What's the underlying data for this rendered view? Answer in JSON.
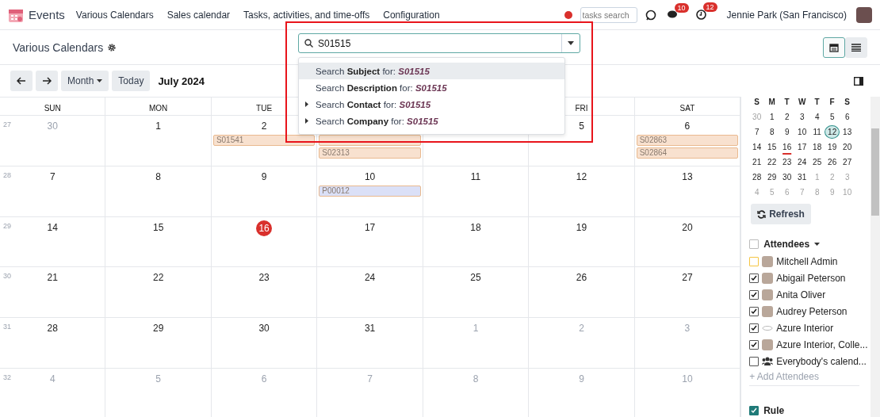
{
  "navbar": {
    "app_name": "Events",
    "menus": [
      "Various Calendars",
      "Sales calendar",
      "Tasks, activities, and time-offs",
      "Configuration"
    ],
    "tasks_search": {
      "placeholder": "tasks search"
    },
    "messages_badge": "10",
    "activities_badge": "12",
    "user": "Jennie Park (San Francisco)"
  },
  "control_panel": {
    "breadcrumb": "Various Calendars",
    "search": {
      "value": "S01515"
    },
    "suggestions": [
      {
        "prefix": "Search",
        "field": "Subject",
        "middle": "for:",
        "term": "S01515",
        "expandable": false,
        "selected": true
      },
      {
        "prefix": "Search",
        "field": "Description",
        "middle": "for:",
        "term": "S01515",
        "expandable": false,
        "selected": false
      },
      {
        "prefix": "Search",
        "field": "Contact",
        "middle": "for:",
        "term": "S01515",
        "expandable": true,
        "selected": false
      },
      {
        "prefix": "Search",
        "field": "Company",
        "middle": "for:",
        "term": "S01515",
        "expandable": true,
        "selected": false
      }
    ],
    "views": [
      {
        "kind": "calendar",
        "selected": true
      },
      {
        "kind": "list",
        "selected": false
      }
    ]
  },
  "toolbar": {
    "scale": "Month",
    "today": "Today",
    "period": "July 2024"
  },
  "calendar": {
    "weekdays_left": [
      "SUN",
      "MON",
      "TUE"
    ],
    "weekdays_right": [
      "FRI",
      "SAT"
    ],
    "weeks": [
      {
        "number": "27",
        "days_left": [
          {
            "label": "30",
            "muted": true,
            "today": false
          },
          {
            "label": "1",
            "muted": false,
            "today": false
          },
          {
            "label": "2",
            "muted": false,
            "today": false,
            "events": [
              {
                "label": "S01541",
                "color": "#f8e1cf"
              }
            ]
          },
          {
            "events": [
              {
                "color": "#f8e1cf"
              },
              {
                "label": "S02313",
                "color": "#f8e1cf"
              }
            ]
          }
        ],
        "days_right": [
          {
            "label": "5",
            "muted": false,
            "today": false
          },
          {
            "label": "6",
            "muted": false,
            "today": false,
            "events": [
              {
                "label": "S02863",
                "color": "#f8e1cf"
              },
              {
                "label": "S02864",
                "color": "#f8e1cf"
              }
            ]
          }
        ]
      },
      {
        "number": "28",
        "days": [
          {
            "label": "7",
            "muted": false,
            "today": false
          },
          {
            "label": "8",
            "muted": false,
            "today": false
          },
          {
            "label": "9",
            "muted": false,
            "today": false
          },
          {
            "label": "10",
            "muted": false,
            "today": false,
            "events": [
              {
                "label": "P00012",
                "color": "#dbe0f7"
              }
            ]
          },
          {
            "label": "11",
            "muted": false,
            "today": false
          },
          {
            "label": "12",
            "muted": false,
            "today": false
          },
          {
            "label": "13",
            "muted": false,
            "today": false
          }
        ]
      },
      {
        "number": "29",
        "days": [
          {
            "label": "14",
            "muted": false,
            "today": false
          },
          {
            "label": "15",
            "muted": false,
            "today": false
          },
          {
            "label": "16",
            "muted": false,
            "today": true
          },
          {
            "label": "17",
            "muted": false,
            "today": false
          },
          {
            "label": "18",
            "muted": false,
            "today": false
          },
          {
            "label": "19",
            "muted": false,
            "today": false
          },
          {
            "label": "20",
            "muted": false,
            "today": false
          }
        ]
      },
      {
        "number": "30",
        "days": [
          {
            "label": "21",
            "muted": false,
            "today": false
          },
          {
            "label": "22",
            "muted": false,
            "today": false
          },
          {
            "label": "23",
            "muted": false,
            "today": false
          },
          {
            "label": "24",
            "muted": false,
            "today": false
          },
          {
            "label": "25",
            "muted": false,
            "today": false
          },
          {
            "label": "26",
            "muted": false,
            "today": false
          },
          {
            "label": "27",
            "muted": false,
            "today": false
          }
        ]
      },
      {
        "number": "31",
        "days": [
          {
            "label": "28",
            "muted": false,
            "today": false
          },
          {
            "label": "29",
            "muted": false,
            "today": false
          },
          {
            "label": "30",
            "muted": false,
            "today": false
          },
          {
            "label": "31",
            "muted": false,
            "today": false
          },
          {
            "label": "1",
            "muted": true,
            "today": false
          },
          {
            "label": "2",
            "muted": true,
            "today": false
          },
          {
            "label": "3",
            "muted": true,
            "today": false
          }
        ]
      },
      {
        "number": "32",
        "days": [
          {
            "label": "4",
            "muted": true,
            "today": false
          },
          {
            "label": "5",
            "muted": true,
            "today": false
          },
          {
            "label": "6",
            "muted": true,
            "today": false
          },
          {
            "label": "7",
            "muted": true,
            "today": false
          },
          {
            "label": "8",
            "muted": true,
            "today": false
          },
          {
            "label": "9",
            "muted": true,
            "today": false
          },
          {
            "label": "10",
            "muted": true,
            "today": false
          }
        ]
      }
    ]
  },
  "mini_calendar": {
    "weekdays": [
      "S",
      "M",
      "T",
      "W",
      "T",
      "F",
      "S"
    ],
    "weeks": [
      [
        {
          "label": "30",
          "muted": true,
          "today": false,
          "selected": false
        },
        {
          "label": "1",
          "muted": false,
          "today": false,
          "selected": false
        },
        {
          "label": "2",
          "muted": false,
          "today": false,
          "selected": false
        },
        {
          "label": "3",
          "muted": false,
          "today": false,
          "selected": false
        },
        {
          "label": "4",
          "muted": false,
          "today": false,
          "selected": false
        },
        {
          "label": "5",
          "muted": false,
          "today": false,
          "selected": false
        },
        {
          "label": "6",
          "muted": false,
          "today": false,
          "selected": false
        }
      ],
      [
        {
          "label": "7",
          "muted": false,
          "today": false,
          "selected": false
        },
        {
          "label": "8",
          "muted": false,
          "today": false,
          "selected": false
        },
        {
          "label": "9",
          "muted": false,
          "today": false,
          "selected": false
        },
        {
          "label": "10",
          "muted": false,
          "today": false,
          "selected": false
        },
        {
          "label": "11",
          "muted": false,
          "today": false,
          "selected": false
        },
        {
          "label": "12",
          "muted": false,
          "today": false,
          "selected": true
        },
        {
          "label": "13",
          "muted": false,
          "today": false,
          "selected": false
        }
      ],
      [
        {
          "label": "14",
          "muted": false,
          "today": false,
          "selected": false
        },
        {
          "label": "15",
          "muted": false,
          "today": false,
          "selected": false
        },
        {
          "label": "16",
          "muted": false,
          "today": true,
          "selected": false
        },
        {
          "label": "17",
          "muted": false,
          "today": false,
          "selected": false
        },
        {
          "label": "18",
          "muted": false,
          "today": false,
          "selected": false
        },
        {
          "label": "19",
          "muted": false,
          "today": false,
          "selected": false
        },
        {
          "label": "20",
          "muted": false,
          "today": false,
          "selected": false
        }
      ],
      [
        {
          "label": "21",
          "muted": false,
          "today": false,
          "selected": false
        },
        {
          "label": "22",
          "muted": false,
          "today": false,
          "selected": false
        },
        {
          "label": "23",
          "muted": false,
          "today": false,
          "selected": false
        },
        {
          "label": "24",
          "muted": false,
          "today": false,
          "selected": false
        },
        {
          "label": "25",
          "muted": false,
          "today": false,
          "selected": false
        },
        {
          "label": "26",
          "muted": false,
          "today": false,
          "selected": false
        },
        {
          "label": "27",
          "muted": false,
          "today": false,
          "selected": false
        }
      ],
      [
        {
          "label": "28",
          "muted": false,
          "today": false,
          "selected": false
        },
        {
          "label": "29",
          "muted": false,
          "today": false,
          "selected": false
        },
        {
          "label": "30",
          "muted": false,
          "today": false,
          "selected": false
        },
        {
          "label": "31",
          "muted": false,
          "today": false,
          "selected": false
        },
        {
          "label": "1",
          "muted": true,
          "today": false,
          "selected": false
        },
        {
          "label": "2",
          "muted": true,
          "today": false,
          "selected": false
        },
        {
          "label": "3",
          "muted": true,
          "today": false,
          "selected": false
        }
      ],
      [
        {
          "label": "4",
          "muted": true,
          "today": false,
          "selected": false
        },
        {
          "label": "5",
          "muted": true,
          "today": false,
          "selected": false
        },
        {
          "label": "6",
          "muted": true,
          "today": false,
          "selected": false
        },
        {
          "label": "7",
          "muted": true,
          "today": false,
          "selected": false
        },
        {
          "label": "8",
          "muted": true,
          "today": false,
          "selected": false
        },
        {
          "label": "9",
          "muted": true,
          "today": false,
          "selected": false
        },
        {
          "label": "10",
          "muted": true,
          "today": false,
          "selected": false
        }
      ]
    ]
  },
  "refresh": "Refresh",
  "attendees": {
    "title": "Attendees",
    "checked": false,
    "items": [
      {
        "name": "Mitchell Admin",
        "checked": false,
        "color": "#f5c542",
        "kind": "person"
      },
      {
        "name": "Abigail Peterson",
        "checked": true,
        "color": "#555555",
        "kind": "person"
      },
      {
        "name": "Anita Oliver",
        "checked": true,
        "color": "#555555",
        "kind": "person"
      },
      {
        "name": "Audrey Peterson",
        "checked": true,
        "color": "#555555",
        "kind": "person"
      },
      {
        "name": "Azure Interior",
        "checked": true,
        "color": "#555555",
        "kind": "company"
      },
      {
        "name": "Azure Interior, Colle...",
        "checked": true,
        "color": "#555555",
        "kind": "person"
      },
      {
        "name": "Everybody's calend...",
        "checked": false,
        "color": "#555555",
        "kind": "group"
      }
    ],
    "add": "+ Add Attendees"
  },
  "rule": {
    "title": "Rule",
    "checked": true
  }
}
